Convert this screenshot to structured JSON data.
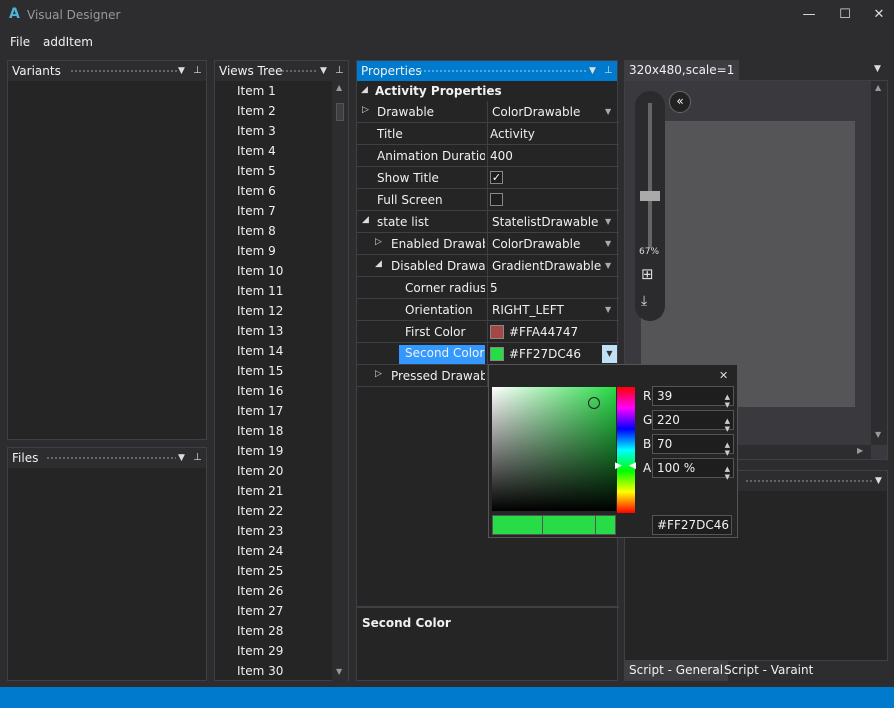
{
  "app": {
    "logo": "A",
    "title": "Visual Designer"
  },
  "window": {
    "minimize": "—",
    "maximize": "☐",
    "close": "✕"
  },
  "menu": {
    "file": "File",
    "add_item": "addItem"
  },
  "variants_panel": {
    "title": "Variants"
  },
  "files_panel": {
    "title": "Files"
  },
  "views_tree": {
    "title": "Views Tree",
    "items": [
      "Item 1",
      "Item 2",
      "Item 3",
      "Item 4",
      "Item 5",
      "Item 6",
      "Item 7",
      "Item 8",
      "Item 9",
      "Item 10",
      "Item 11",
      "Item 12",
      "Item 13",
      "Item 14",
      "Item 15",
      "Item 16",
      "Item 17",
      "Item 18",
      "Item 19",
      "Item 20",
      "Item 21",
      "Item 22",
      "Item 23",
      "Item 24",
      "Item 25",
      "Item 26",
      "Item 27",
      "Item 28",
      "Item 29",
      "Item 30"
    ]
  },
  "properties": {
    "title": "Properties",
    "section": "Activity Properties",
    "rows": [
      {
        "name": "Drawable",
        "value": "ColorDrawable"
      },
      {
        "name": "Title",
        "value": "Activity"
      },
      {
        "name": "Animation Duration",
        "value": "400"
      },
      {
        "name": "Show Title",
        "value": "✓"
      },
      {
        "name": "Full Screen",
        "value": ""
      },
      {
        "name": "state list",
        "value": "StatelistDrawable"
      },
      {
        "name": "Enabled Drawable",
        "value": "ColorDrawable"
      },
      {
        "name": "Disabled Drawable",
        "value": "GradientDrawable"
      },
      {
        "name": "Corner radius",
        "value": "5"
      },
      {
        "name": "Orientation",
        "value": "RIGHT_LEFT"
      },
      {
        "name": "First Color",
        "value": "#FFA44747"
      },
      {
        "name": "Second Color",
        "value": "#FF27DC46"
      },
      {
        "name": "Pressed Drawable",
        "value": ""
      }
    ],
    "description_title": "Second Color"
  },
  "colors": {
    "first": "#a44747",
    "second": "#27dc46",
    "accent": "#007acc"
  },
  "color_picker": {
    "close": "✕",
    "r_label": "R",
    "r_value": "39",
    "g_label": "G",
    "g_value": "220",
    "b_label": "B",
    "b_value": "70",
    "a_label": "A",
    "a_value": "100 %",
    "hex": "#FF27DC46"
  },
  "preview": {
    "tab": "320x480,scale=1",
    "zoom": "67%"
  },
  "bottom_tabs": {
    "general": "Script - General",
    "variant": "Script - Varaint"
  }
}
